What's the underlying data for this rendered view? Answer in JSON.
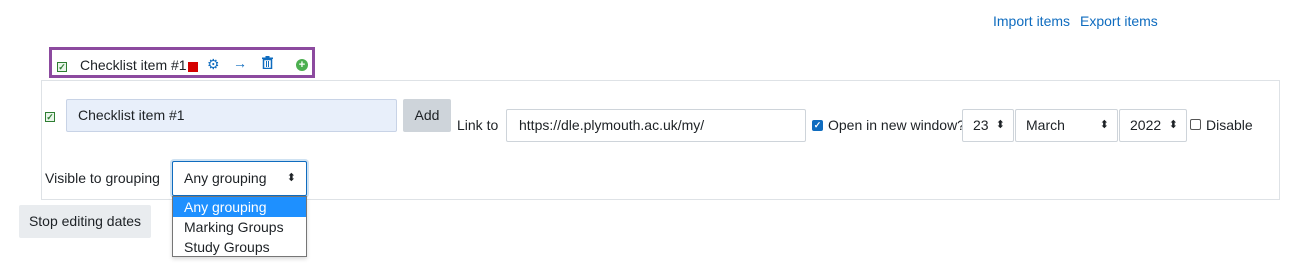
{
  "header_links": {
    "import": "Import items",
    "export": "Export items"
  },
  "item": {
    "label": "Checklist item #1",
    "checkbox_icon": "check-square-icon",
    "colour_marker": "#d50000",
    "actions": [
      "gear-icon",
      "arrow-right-icon",
      "trash-icon",
      "add-circle-icon"
    ]
  },
  "editor": {
    "item_value": "Checklist item #1",
    "add_label": "Add",
    "link_label": "Link to",
    "link_value": "https://dle.plymouth.ac.uk/my/",
    "open_new_window_label": "Open in new window?",
    "open_new_window_checked": true,
    "date": {
      "day": "23",
      "month": "March",
      "year": "2022"
    },
    "disable_label": "Disable",
    "disable_checked": false,
    "grouping_label": "Visible to grouping",
    "grouping_value": "Any grouping",
    "grouping_options": [
      "Any grouping",
      "Marking Groups",
      "Study Groups"
    ]
  },
  "stop_editing_label": "Stop editing dates",
  "colors": {
    "link": "#0f6cbf",
    "highlight_border": "#8c4a9f",
    "dropdown_selected": "#1e90ff"
  }
}
